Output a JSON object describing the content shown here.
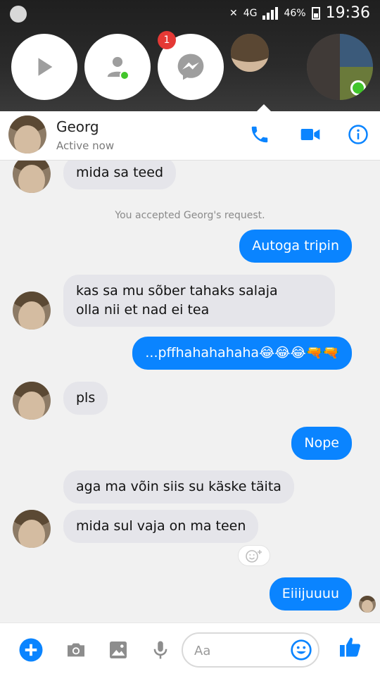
{
  "status_bar": {
    "network": "4G",
    "battery": "46%",
    "time": "19:36"
  },
  "chat_heads": {
    "badge": "1"
  },
  "header": {
    "name": "Georg",
    "status": "Active now"
  },
  "messages": {
    "m1": "mida sa teed",
    "system": "You accepted Georg's request.",
    "m2": "Autoga tripin",
    "m3_line1": "kas sa mu sõber tahaks salaja",
    "m3_line2": "olla nii et nad ei tea",
    "m4": "...pffhahahahaha😂😂😂🔫🔫",
    "m5": "pls",
    "m6": "Nope",
    "m7": "aga ma võin siis su käske täita",
    "m8": "mida sul vaja on ma teen",
    "m9": "Eiiijuuuu"
  },
  "composer": {
    "placeholder": "Aa"
  },
  "colors": {
    "accent": "#0a84ff",
    "online": "#42c52b",
    "badge": "#e53935"
  }
}
